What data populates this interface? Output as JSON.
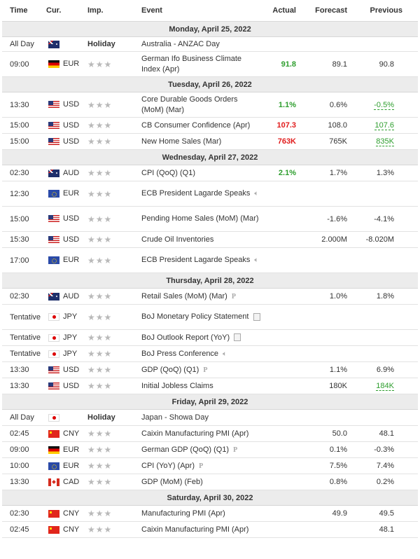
{
  "headers": {
    "time": "Time",
    "cur": "Cur.",
    "imp": "Imp.",
    "event": "Event",
    "actual": "Actual",
    "forecast": "Forecast",
    "previous": "Previous"
  },
  "colors": {
    "good": "#2e9e2e",
    "bad": "#e11c1c",
    "day_bg": "#ececec"
  },
  "rows": [
    {
      "type": "day",
      "label": "Monday, April 25, 2022"
    },
    {
      "type": "event",
      "time": "All Day",
      "flag": "australia-flag",
      "cur": "",
      "imp": "Holiday",
      "event": "Australia - ANZAC Day",
      "actual": "",
      "forecast": "",
      "previous": ""
    },
    {
      "type": "event",
      "time": "09:00",
      "flag": "germany-flag",
      "cur": "EUR",
      "imp": "★★★",
      "event": "German Ifo Business Climate Index (Apr)",
      "actual": "91.8",
      "actual_class": "good",
      "forecast": "89.1",
      "previous": "90.8"
    },
    {
      "type": "day",
      "label": "Tuesday, April 26, 2022"
    },
    {
      "type": "event",
      "time": "13:30",
      "flag": "usa-flag",
      "cur": "USD",
      "imp": "★★★",
      "event": "Core Durable Goods Orders (MoM) (Mar)",
      "actual": "1.1%",
      "actual_class": "good",
      "forecast": "0.6%",
      "previous": "-0.5%",
      "previous_class": "prevgood"
    },
    {
      "type": "event",
      "time": "15:00",
      "flag": "usa-flag",
      "cur": "USD",
      "imp": "★★★",
      "event": "CB Consumer Confidence (Apr)",
      "actual": "107.3",
      "actual_class": "bad",
      "forecast": "108.0",
      "previous": "107.6",
      "previous_class": "prevgood"
    },
    {
      "type": "event",
      "time": "15:00",
      "flag": "usa-flag",
      "cur": "USD",
      "imp": "★★★",
      "event": "New Home Sales (Mar)",
      "actual": "763K",
      "actual_class": "bad",
      "forecast": "765K",
      "previous": "835K",
      "previous_class": "prevgood"
    },
    {
      "type": "day",
      "label": "Wednesday, April 27, 2022"
    },
    {
      "type": "event",
      "time": "02:30",
      "flag": "australia-flag",
      "cur": "AUD",
      "imp": "★★★",
      "event": "CPI (QoQ) (Q1)",
      "actual": "2.1%",
      "actual_class": "good",
      "forecast": "1.7%",
      "previous": "1.3%"
    },
    {
      "type": "event",
      "time": "12:30",
      "flag": "eu-flag",
      "cur": "EUR",
      "imp": "★★★",
      "event": "ECB President Lagarde Speaks",
      "icon": "speaker",
      "actual": "",
      "forecast": "",
      "previous": ""
    },
    {
      "type": "event",
      "time": "15:00",
      "flag": "usa-flag",
      "cur": "USD",
      "imp": "★★★",
      "event": "Pending Home Sales (MoM) (Mar)",
      "actual": "",
      "forecast": "-1.6%",
      "previous": "-4.1%"
    },
    {
      "type": "event",
      "time": "15:30",
      "flag": "usa-flag",
      "cur": "USD",
      "imp": "★★★",
      "event": "Crude Oil Inventories",
      "actual": "",
      "forecast": "2.000M",
      "previous": "-8.020M"
    },
    {
      "type": "event",
      "time": "17:00",
      "flag": "eu-flag",
      "cur": "EUR",
      "imp": "★★★",
      "event": "ECB President Lagarde Speaks",
      "icon": "speaker",
      "actual": "",
      "forecast": "",
      "previous": ""
    },
    {
      "type": "day",
      "label": "Thursday, April 28, 2022"
    },
    {
      "type": "event",
      "time": "02:30",
      "flag": "australia-flag",
      "cur": "AUD",
      "imp": "★★★",
      "event": "Retail Sales (MoM) (Mar)",
      "icon": "preliminary",
      "actual": "",
      "forecast": "1.0%",
      "previous": "1.8%"
    },
    {
      "type": "event",
      "time": "Tentative",
      "flag": "japan-flag",
      "cur": "JPY",
      "imp": "★★★",
      "event": "BoJ Monetary Policy Statement",
      "icon": "document",
      "actual": "",
      "forecast": "",
      "previous": ""
    },
    {
      "type": "event",
      "time": "Tentative",
      "flag": "japan-flag",
      "cur": "JPY",
      "imp": "★★★",
      "event": "BoJ Outlook Report (YoY)",
      "icon": "document",
      "actual": "",
      "forecast": "",
      "previous": ""
    },
    {
      "type": "event",
      "time": "Tentative",
      "flag": "japan-flag",
      "cur": "JPY",
      "imp": "★★★",
      "event": "BoJ Press Conference",
      "icon": "speaker",
      "actual": "",
      "forecast": "",
      "previous": ""
    },
    {
      "type": "event",
      "time": "13:30",
      "flag": "usa-flag",
      "cur": "USD",
      "imp": "★★★",
      "event": "GDP (QoQ) (Q1)",
      "icon": "preliminary",
      "actual": "",
      "forecast": "1.1%",
      "previous": "6.9%"
    },
    {
      "type": "event",
      "time": "13:30",
      "flag": "usa-flag",
      "cur": "USD",
      "imp": "★★★",
      "event": "Initial Jobless Claims",
      "actual": "",
      "forecast": "180K",
      "previous": "184K",
      "previous_class": "prevgood"
    },
    {
      "type": "day",
      "label": "Friday, April 29, 2022"
    },
    {
      "type": "event",
      "time": "All Day",
      "flag": "japan-flag",
      "cur": "",
      "imp": "Holiday",
      "event": "Japan - Showa Day",
      "actual": "",
      "forecast": "",
      "previous": ""
    },
    {
      "type": "event",
      "time": "02:45",
      "flag": "china-flag",
      "cur": "CNY",
      "imp": "★★★",
      "event": "Caixin Manufacturing PMI (Apr)",
      "actual": "",
      "forecast": "50.0",
      "previous": "48.1"
    },
    {
      "type": "event",
      "time": "09:00",
      "flag": "germany-flag",
      "cur": "EUR",
      "imp": "★★★",
      "event": "German GDP (QoQ) (Q1)",
      "icon": "preliminary",
      "actual": "",
      "forecast": "0.1%",
      "previous": "-0.3%"
    },
    {
      "type": "event",
      "time": "10:00",
      "flag": "eu-flag",
      "cur": "EUR",
      "imp": "★★★",
      "event": "CPI (YoY) (Apr)",
      "icon": "preliminary",
      "actual": "",
      "forecast": "7.5%",
      "previous": "7.4%"
    },
    {
      "type": "event",
      "time": "13:30",
      "flag": "canada-flag",
      "cur": "CAD",
      "imp": "★★★",
      "event": "GDP (MoM) (Feb)",
      "actual": "",
      "forecast": "0.8%",
      "previous": "0.2%"
    },
    {
      "type": "day",
      "label": "Saturday, April 30, 2022"
    },
    {
      "type": "event",
      "time": "02:30",
      "flag": "china-flag",
      "cur": "CNY",
      "imp": "★★★",
      "event": "Manufacturing PMI (Apr)",
      "actual": "",
      "forecast": "49.9",
      "previous": "49.5"
    },
    {
      "type": "event",
      "time": "02:45",
      "flag": "china-flag",
      "cur": "CNY",
      "imp": "★★★",
      "event": "Caixin Manufacturing PMI (Apr)",
      "actual": "",
      "forecast": "",
      "previous": "48.1"
    }
  ]
}
